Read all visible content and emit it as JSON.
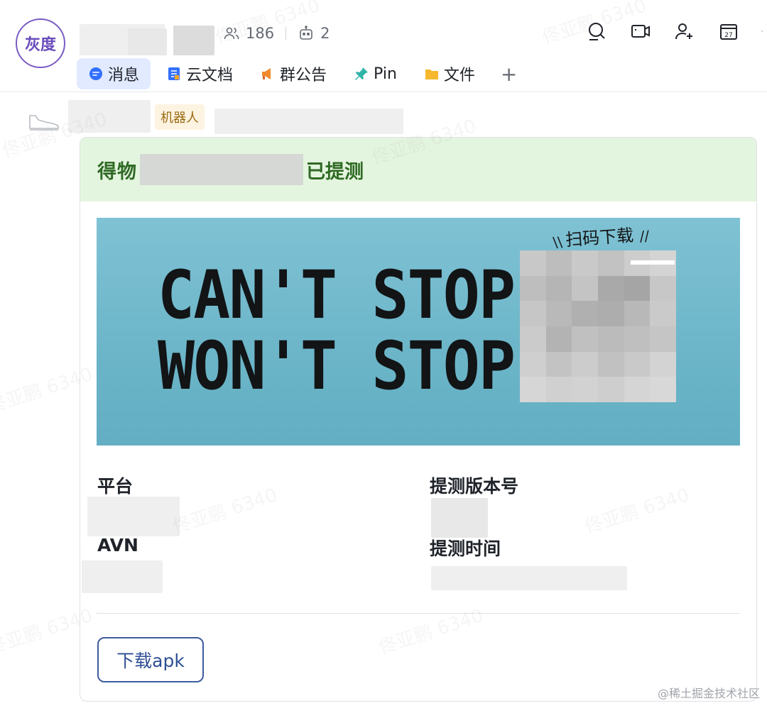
{
  "header": {
    "avatar_text": "灰度",
    "member_count": "186",
    "bot_count": "2"
  },
  "tabs": [
    {
      "label": "消息",
      "icon": "message-icon"
    },
    {
      "label": "云文档",
      "icon": "doc-icon"
    },
    {
      "label": "群公告",
      "icon": "announcement-icon"
    },
    {
      "label": "Pin",
      "icon": "pin-icon"
    },
    {
      "label": "文件",
      "icon": "folder-icon"
    }
  ],
  "tab_add": "+",
  "message": {
    "bot_badge": "机器人",
    "card": {
      "title_prefix": "得物",
      "title_suffix": "已提测",
      "banner_line1": "CAN'T STOP",
      "banner_line2": "WON'T STOP",
      "scan_label": "扫码下载",
      "fields": [
        {
          "label": "平台"
        },
        {
          "label": "提测版本号"
        },
        {
          "label": "AVN"
        },
        {
          "label": "提测时间"
        }
      ],
      "download_button": "下载apk"
    }
  },
  "watermark": "佟亚鹏 6340",
  "footer_note": "@稀土掘金技术社区",
  "colors": {
    "tab_active_bg": "#e1eaff",
    "card_header_bg": "#e4f5df",
    "card_title": "#2f6a24",
    "button_border": "#3d5c9e",
    "avatar_border": "#7b5cc4"
  }
}
